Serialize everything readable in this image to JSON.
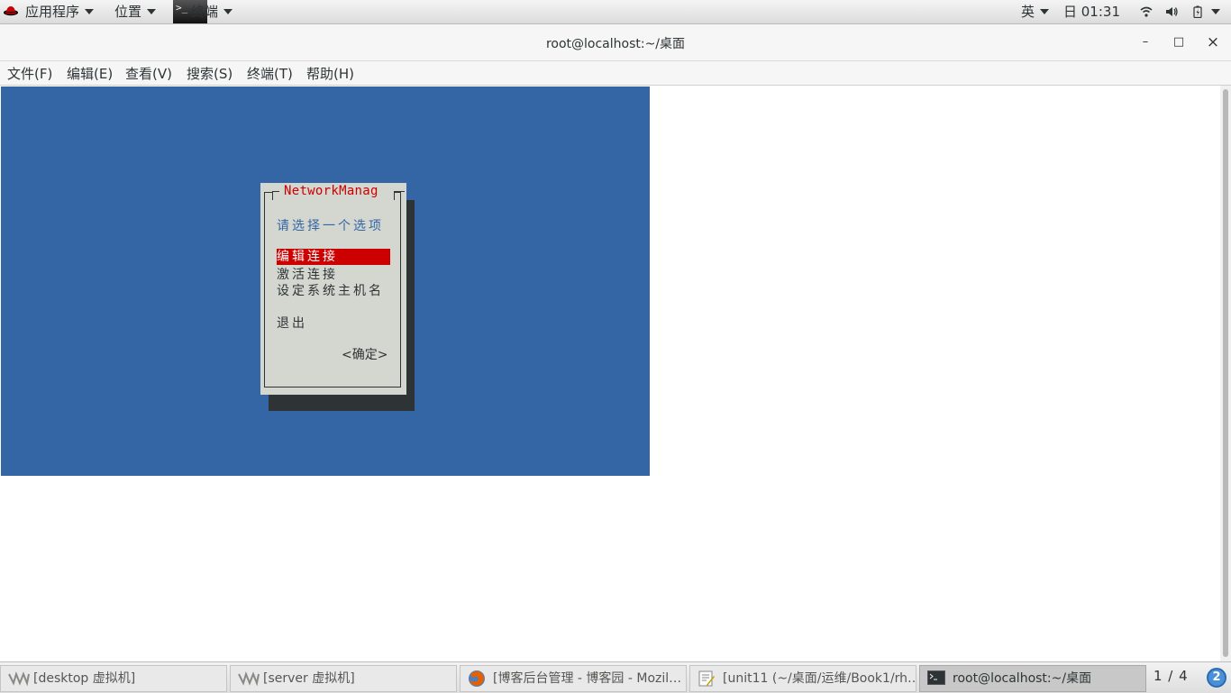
{
  "topbar": {
    "apps_label": "应用程序",
    "places_label": "位置",
    "terminal_label": "终端",
    "ime_label": "英",
    "clock": "日 01:31"
  },
  "window": {
    "title": "root@localhost:~/桌面",
    "minimize": "–",
    "maximize": "□",
    "close": "×"
  },
  "menubar": {
    "items": [
      "文件(F)",
      "编辑(E)",
      "查看(V)",
      "搜索(S)",
      "终端(T)",
      "帮助(H)"
    ]
  },
  "tui": {
    "title": "NetworkManag",
    "prompt": "请选择一个选项",
    "options": [
      "编辑连接",
      "激活连接",
      "设定系统主机名",
      "退出"
    ],
    "selected_index": 0,
    "ok_button": "<确定>"
  },
  "taskbar": {
    "tasks": [
      {
        "label": "[desktop 虚拟机]",
        "icon": "virt-manager-icon"
      },
      {
        "label": "[server 虚拟机]",
        "icon": "virt-manager-icon"
      },
      {
        "label": "[博客后台管理 - 博客园 - Mozil…",
        "icon": "firefox-icon"
      },
      {
        "label": "[unit11 (~/桌面/运维/Book1/rh…",
        "icon": "gedit-icon"
      },
      {
        "label": "root@localhost:~/桌面",
        "icon": "terminal-icon"
      }
    ],
    "workspace": "1 / 4",
    "notifications": "2"
  },
  "colors": {
    "tui_background": "#3465a4",
    "dialog": "#d3d7cf",
    "highlight": "#cc0000"
  }
}
